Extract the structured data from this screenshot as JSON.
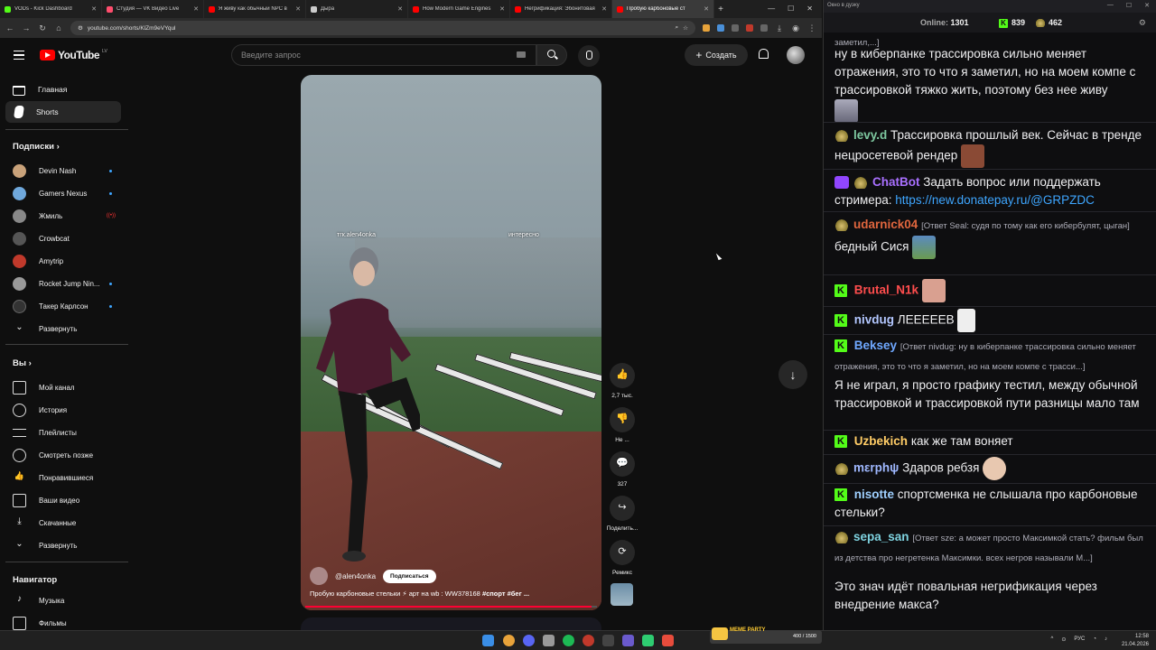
{
  "browser": {
    "tabs": [
      {
        "label": "VODs - Kick Dashboard",
        "color": "#53fc18"
      },
      {
        "label": "Студия — VK Видео Live",
        "color": "#ff4d6d"
      },
      {
        "label": "Я живу как обычный NPC в",
        "color": "#ff0000"
      },
      {
        "label": "Дыра",
        "color": "#cccccc"
      },
      {
        "label": "How Modern Game Engines",
        "color": "#ff0000"
      },
      {
        "label": "Негрификация: Эбонитовая",
        "color": "#ff0000"
      },
      {
        "label": "Пробую карбоновые ст",
        "color": "#ff0000"
      }
    ],
    "url": "youtube.com/shorts/KlZm9eVYqul"
  },
  "youtube": {
    "logo_text": "YouTube",
    "country": "LV",
    "search_placeholder": "Введите запрос",
    "create_label": "Создать",
    "nav": [
      {
        "label": "Главная"
      },
      {
        "label": "Shorts"
      }
    ],
    "subs_heading": "Подписки",
    "subscriptions": [
      {
        "name": "Devin Nash",
        "color": "#c9a27a",
        "marker": "dot"
      },
      {
        "name": "Gamers Nexus",
        "color": "#6fa8dc",
        "marker": "dot"
      },
      {
        "name": "Жмиль",
        "color": "#888888",
        "marker": "live"
      },
      {
        "name": "Crowbcat",
        "color": "#555555",
        "marker": ""
      },
      {
        "name": "Amytrip",
        "color": "#c0392b",
        "marker": ""
      },
      {
        "name": "Rocket Jump Nin...",
        "color": "#999999",
        "marker": "dot"
      },
      {
        "name": "Такер Карлсон",
        "color": "#333333",
        "marker": "dot"
      }
    ],
    "expand_label": "Развернуть",
    "you_heading": "Вы",
    "you_items": [
      {
        "label": "Мой канал"
      },
      {
        "label": "История"
      },
      {
        "label": "Плейлисты"
      },
      {
        "label": "Смотреть позже"
      },
      {
        "label": "Понравившиеся"
      },
      {
        "label": "Ваши видео"
      },
      {
        "label": "Скачанные"
      },
      {
        "label": "Развернуть"
      }
    ],
    "nav_heading": "Навигатор",
    "nav_items": [
      {
        "label": "Музыка"
      },
      {
        "label": "Фильмы"
      }
    ]
  },
  "short": {
    "overlay_left": "тгк.alen4onka",
    "overlay_right": "интересно",
    "channel": "@alen4onka",
    "subscribe_label": "Подписаться",
    "description_plain": "Пробую карбоновые стельки ⚡ арт на wb : WW378168 ",
    "description_bold": "#спорт #бег ...",
    "progress": 0.98,
    "actions": [
      {
        "name": "like",
        "glyph": "👍",
        "label": "2,7 тыс."
      },
      {
        "name": "dislike",
        "glyph": "👎",
        "label": "Не ..."
      },
      {
        "name": "comments",
        "glyph": "💬",
        "label": "327"
      },
      {
        "name": "share",
        "glyph": "↪",
        "label": "Поделить..."
      },
      {
        "name": "remix",
        "glyph": "⟳",
        "label": "Ремикс"
      }
    ]
  },
  "chat": {
    "window_title": "Окно в дуэку",
    "online_label": "Online:",
    "online_count": "1301",
    "kick_count": "839",
    "other_count": "462",
    "messages": [
      {
        "prefix": "",
        "user": "",
        "color": "#efeff1",
        "reply": "заметил,...]",
        "text": ""
      },
      {
        "prefix": "",
        "user": "",
        "color": "#efeff1",
        "reply": "",
        "text": "ну в киберпанке трассировка сильно меняет отражения, это то что я заметил, но на моем компе с трассировкой тяжко жить, поэтому без нее живу"
      },
      {
        "prefix": "frog",
        "user": "levy.d",
        "color": "#7ec8a0",
        "reply": "",
        "text": "Трассировка прошлый век. Сейчас в тренде нецросетевой рендер"
      },
      {
        "prefix": "robot",
        "user": "ChatBot",
        "color": "#a970ff",
        "reply": "",
        "text": "Задать вопрос или поддержать стримера: ",
        "link": "https://new.donatepay.ru/@GRPZDC"
      },
      {
        "prefix": "frog",
        "user": "udarnick04",
        "color": "#e0663e",
        "reply": "[Ответ Seal: судя по тому как его кибербулят, цыган]",
        "text": "бедный Сися"
      },
      {
        "prefix": "kick",
        "user": "Brutal_N1k",
        "color": "#ff4d4d",
        "reply": "",
        "text": ""
      },
      {
        "prefix": "kick",
        "user": "nivdug",
        "color": "#b3c7ff",
        "reply": "",
        "text": "ЛЕЕЕЕЕВ"
      },
      {
        "prefix": "kick",
        "user": "Beksey",
        "color": "#6fa8ff",
        "reply": "[Ответ nivdug: ну в киберпанке трассировка сильно меняет отражения, это то что я заметил, но на моем компе с трасси...]",
        "text": "Я не играл, я просто графику тестил, между обычной трассировкой и трассировкой пути разницы мало там"
      },
      {
        "prefix": "kick",
        "user": "Uzbekich",
        "color": "#ffcc66",
        "reply": "",
        "text": "как же там воняет"
      },
      {
        "prefix": "frog",
        "user": "mεrphψ",
        "color": "#9fb8ff",
        "reply": "",
        "text": "Здаров ребзя"
      },
      {
        "prefix": "kick",
        "user": "nisotte",
        "color": "#9fd0ff",
        "reply": "",
        "text": "спортсменка не слышала про карбоновые стельки?"
      },
      {
        "prefix": "frog",
        "user": "sepa_san",
        "color": "#7fd3e0",
        "reply": "[Ответ sze: а может просто Максимкой стать? фильм был из детства про негретенка Максимки. всех негров называли М...]",
        "text": ""
      },
      {
        "prefix": "",
        "user": "",
        "color": "#efeff1",
        "reply": "",
        "text": "Это знач идёт повальная негрификация через внедрение макса?"
      }
    ]
  },
  "taskbar": {
    "widget_label": "MEME PARTY",
    "widget_count": "400 / 1500",
    "lang": "РУС",
    "time": "12:58",
    "date": "21.04.2026"
  }
}
